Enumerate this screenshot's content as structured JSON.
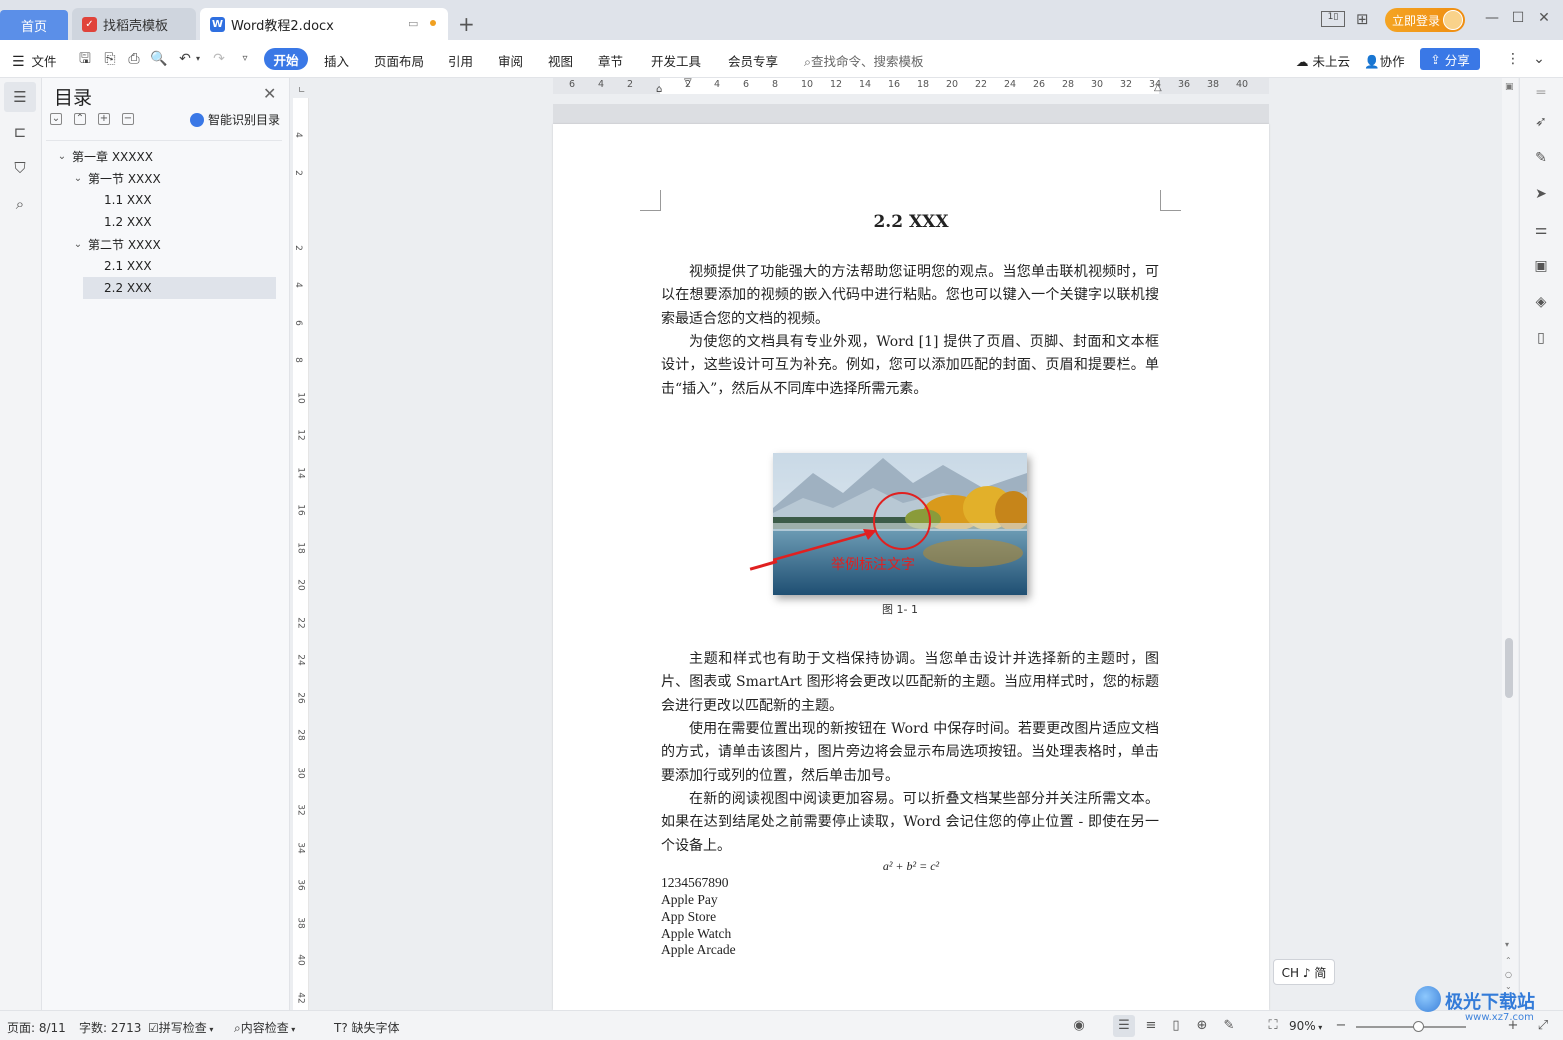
{
  "tabs": {
    "home": "首页",
    "daoke": "找稻壳模板",
    "doc": "Word教程2.docx"
  },
  "titlebar": {
    "login": "立即登录"
  },
  "toolbar": {
    "file": "文件",
    "menu": [
      "开始",
      "插入",
      "页面布局",
      "引用",
      "审阅",
      "视图",
      "章节",
      "开发工具",
      "会员专享"
    ],
    "search_placeholder": "查找命令、搜索模板",
    "cloud": "未上云",
    "collab": "协作",
    "share": "分享"
  },
  "toc": {
    "title": "目录",
    "smart": "智能识别目录",
    "items": [
      {
        "label": "第一章  XXXXX",
        "level": 1,
        "expand": true
      },
      {
        "label": "第一节  XXXX",
        "level": 2,
        "expand": true
      },
      {
        "label": "1.1 XXX",
        "level": 3
      },
      {
        "label": "1.2 XXX",
        "level": 3
      },
      {
        "label": "第二节  XXXX",
        "level": 2,
        "expand": true
      },
      {
        "label": "2.1 XXX",
        "level": 3
      },
      {
        "label": "2.2 XXX",
        "level": 3,
        "selected": true
      }
    ]
  },
  "ruler": {
    "h_ticks": [
      "6",
      "4",
      "2",
      "",
      "2",
      "4",
      "6",
      "8",
      "10",
      "12",
      "14",
      "16",
      "18",
      "20",
      "22",
      "24",
      "26",
      "28",
      "30",
      "32",
      "34",
      "36",
      "38",
      "40"
    ],
    "v_ticks": [
      "4",
      "2",
      "",
      "2",
      "4",
      "6",
      "8",
      "10",
      "12",
      "14",
      "16",
      "18",
      "20",
      "22",
      "24",
      "26",
      "28",
      "30",
      "32",
      "34",
      "36",
      "38",
      "40",
      "42"
    ]
  },
  "document": {
    "heading": "2.2 XXX",
    "p1": "视频提供了功能强大的方法帮助您证明您的观点。当您单击联机视频时，可以在想要添加的视频的嵌入代码中进行粘贴。您也可以键入一个关键字以联机搜索最适合您的文档的视频。",
    "p2": "为使您的文档具有专业外观，Word [1] 提供了页眉、页脚、封面和文本框设计，这些设计可互为补充。例如，您可以添加匹配的封面、页眉和提要栏。单击“插入”，然后从不同库中选择所需元素。",
    "figure_annotation": "举例标注文字",
    "figure_caption": "图 1- 1",
    "p3": "主题和样式也有助于文档保持协调。当您单击设计并选择新的主题时，图片、图表或 SmartArt 图形将会更改以匹配新的主题。当应用样式时，您的标题会进行更改以匹配新的主题。",
    "p4": "使用在需要位置出现的新按钮在 Word 中保存时间。若要更改图片适应文档的方式，请单击该图片，图片旁边将会显示布局选项按钮。当处理表格时，单击要添加行或列的位置，然后单击加号。",
    "p5": "在新的阅读视图中阅读更加容易。可以折叠文档某些部分并关注所需文本。如果在达到结尾处之前需要停止读取，Word 会记住您的停止位置 - 即使在另一个设备上。",
    "formula": "a² + b² = c²",
    "list": [
      "1234567890",
      "Apple Pay",
      "App Store",
      "Apple Watch",
      "Apple Arcade"
    ]
  },
  "ime": "CH ♪ 简",
  "status": {
    "page": "页面: 8/11",
    "words": "字数: 2713",
    "spell": "拼写检查",
    "content": "内容检查",
    "font": "缺失字体",
    "zoom": "90%"
  },
  "watermark": {
    "text": "极光下载站",
    "url": "www.xz7.com"
  },
  "colors": {
    "accent": "#3a78e6",
    "login": "#f4a423",
    "annotation": "#e02020"
  }
}
